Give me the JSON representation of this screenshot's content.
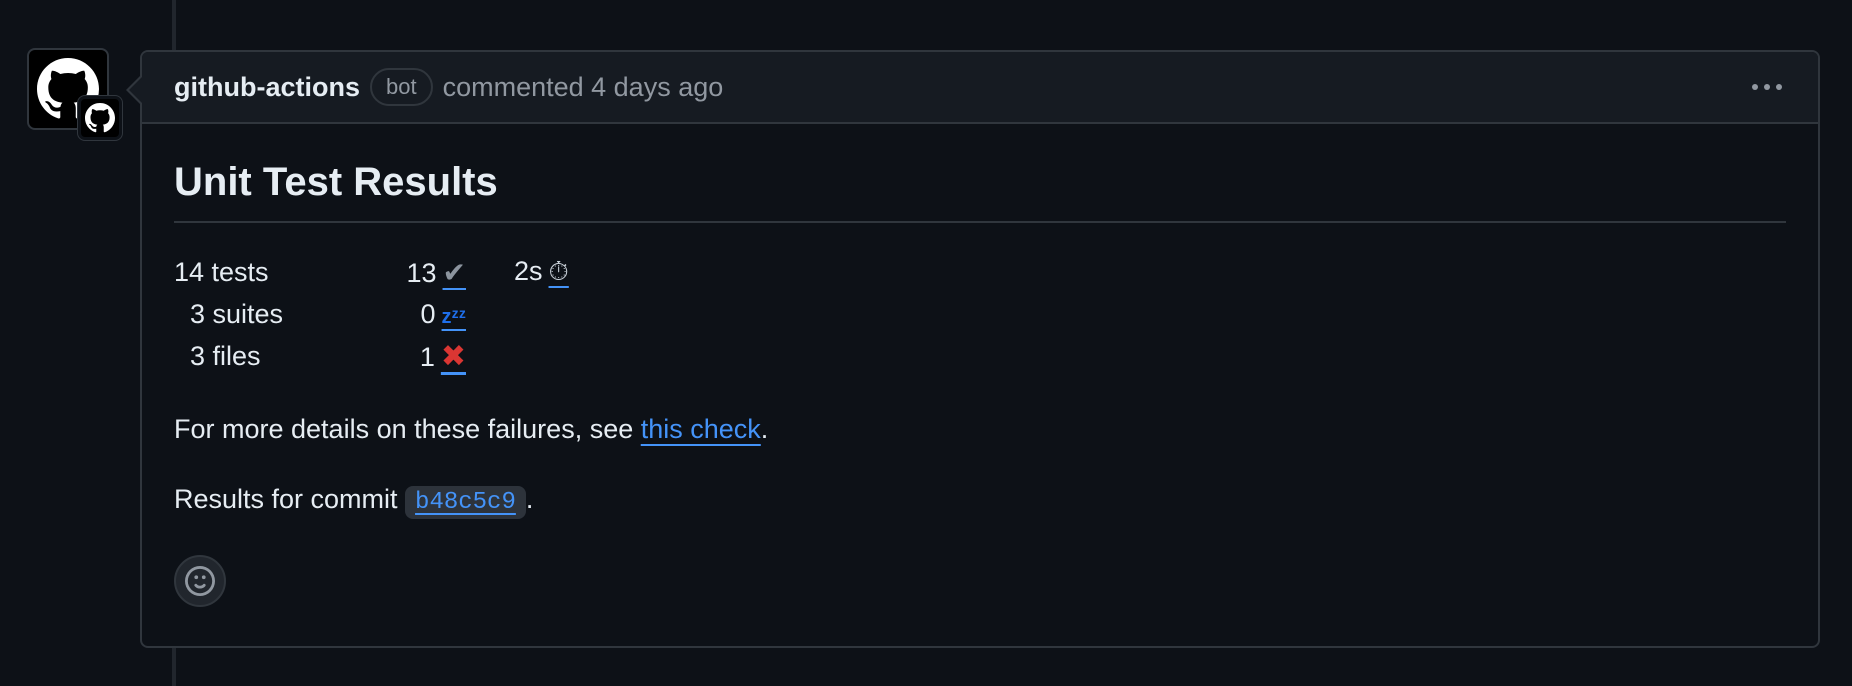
{
  "comment": {
    "author": "github-actions",
    "badge": "bot",
    "meta": "commented 4 days ago",
    "title": "Unit Test Results",
    "stats": {
      "tests": "14 tests",
      "suites": "3 suites",
      "files": "3 files",
      "passed": "13",
      "skipped": "0",
      "failed": "1",
      "duration": "2s",
      "passed_icon": "✔",
      "skipped_icon": "zᶻᶻ",
      "failed_icon": "✖",
      "duration_icon": "⏱"
    },
    "details_prefix": "For more details on these failures, see ",
    "details_link": "this check",
    "details_suffix": ".",
    "commit_prefix": "Results for commit ",
    "commit_sha": "b48c5c9",
    "commit_suffix": "."
  },
  "icons": {
    "avatar": "github-mark-icon",
    "badge": "github-mark-icon",
    "menu": "kebab-horizontal-icon",
    "reaction": "smiley-icon"
  },
  "colors": {
    "background": "#0d1117",
    "header": "#161b22",
    "border": "#30363d",
    "link": "#4493f8",
    "muted": "#9198a1",
    "failure": "#da3633"
  }
}
